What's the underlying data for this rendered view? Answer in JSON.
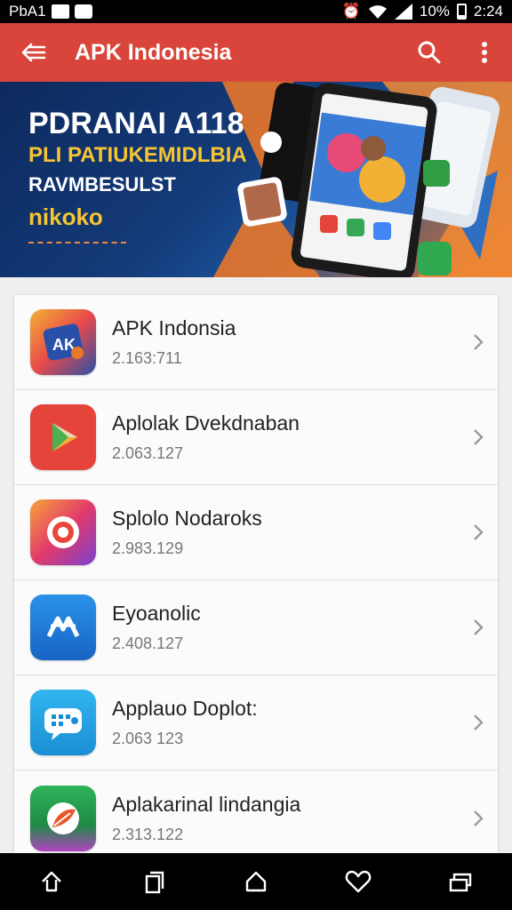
{
  "status": {
    "carrier": "PbA1",
    "battery": "10%",
    "time": "2:24"
  },
  "appbar": {
    "title": "APK Indonesia",
    "back_icon": "back-arrow-icon",
    "search_icon": "search-icon",
    "menu_icon": "more-vert-icon"
  },
  "banner": {
    "line1": "PDRANAI A118",
    "line2": "PLI PATIUKEMIDLBIA",
    "line3": "RAVMBESULST",
    "line4": "nikoko"
  },
  "apps": [
    {
      "name": "APK Indonsia",
      "version": "2.163:711",
      "icon": "apk-indonesia-icon",
      "color": "#2a4fa8"
    },
    {
      "name": "Aplolak Dvekdnaban",
      "version": "2.063.127",
      "icon": "play-store-icon",
      "color": "#e5443b"
    },
    {
      "name": "Splolo Nodaroks",
      "version": "2.983.129",
      "icon": "target-icon",
      "color": "#e23b6a"
    },
    {
      "name": "Eyoanolic",
      "version": "2.408.127",
      "icon": "wave-icon",
      "color": "#1e7fd6"
    },
    {
      "name": "Applauo Doplot:",
      "version": "2.063 123",
      "icon": "chat-icon",
      "color": "#1fa2e0"
    },
    {
      "name": "Aplakarinal lindangia",
      "version": "2.313.122",
      "icon": "leaf-icon",
      "color": "#22a35a"
    }
  ],
  "navbar": [
    "home-up-icon",
    "recents-icon",
    "home-icon",
    "favorite-icon",
    "multiwindow-icon"
  ]
}
